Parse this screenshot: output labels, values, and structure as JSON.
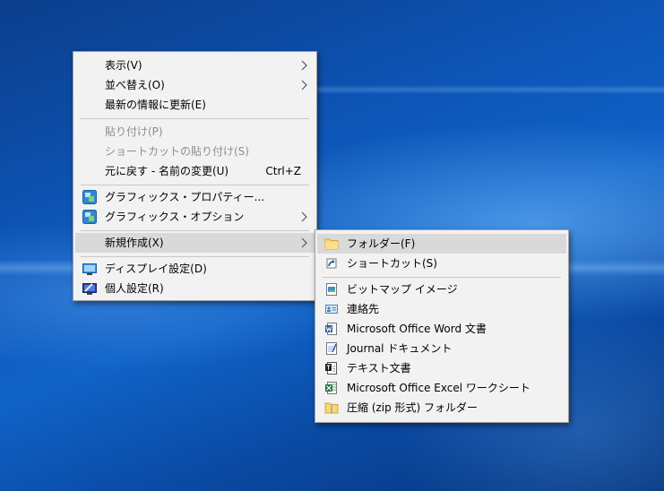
{
  "main_menu": {
    "view": "表示(V)",
    "sort": "並べ替え(O)",
    "refresh": "最新の情報に更新(E)",
    "paste": "貼り付け(P)",
    "paste_shortcut": "ショートカットの貼り付け(S)",
    "undo": "元に戻す - 名前の変更(U)",
    "undo_shortcut": "Ctrl+Z",
    "graphics_properties": "グラフィックス・プロパティー...",
    "graphics_options": "グラフィックス・オプション",
    "new": "新規作成(X)",
    "display_settings": "ディスプレイ設定(D)",
    "personalize": "個人設定(R)"
  },
  "new_submenu": {
    "folder": "フォルダー(F)",
    "shortcut": "ショートカット(S)",
    "bitmap": "ビットマップ イメージ",
    "contact": "連絡先",
    "word": "Microsoft Office Word 文書",
    "journal": "Journal ドキュメント",
    "text": "テキスト文書",
    "excel": "Microsoft Office Excel ワークシート",
    "zip": "圧縮 (zip 形式) フォルダー"
  },
  "icons": {
    "graphics_properties": "intel-graphics-icon",
    "graphics_options": "intel-graphics-icon",
    "display_settings": "display-icon",
    "personalize": "personalize-icon",
    "folder": "folder-icon",
    "shortcut": "shortcut-arrow-icon",
    "bitmap": "bitmap-icon",
    "contact": "contact-card-icon",
    "word": "word-doc-icon",
    "journal": "journal-icon",
    "text": "text-doc-icon",
    "excel": "excel-sheet-icon",
    "zip": "zip-folder-icon"
  },
  "colors": {
    "menu_bg": "#f2f2f2",
    "highlight": "#d9d9d9",
    "disabled_text": "#8d8d8d",
    "desktop": "#0d56b8"
  }
}
